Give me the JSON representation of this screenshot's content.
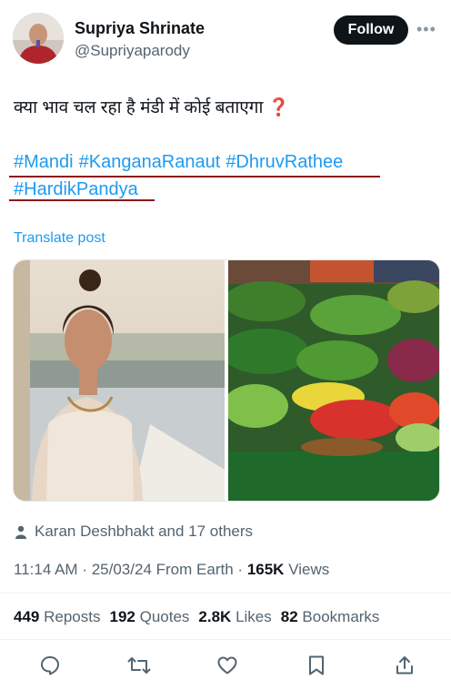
{
  "author": {
    "name": "Supriya Shrinate",
    "handle": "@Supriyaparody",
    "avatar_icon": "avatar-photo"
  },
  "header": {
    "follow_label": "Follow",
    "more_label": "•••"
  },
  "post": {
    "text": "क्या भाव चल रहा है मंडी में कोई बताएगा",
    "question_mark": "❓",
    "hashtags": [
      "#Mandi",
      "#KanganaRanaut",
      "#DhruvRathee",
      "#HardikPandya"
    ],
    "translate_label": "Translate post"
  },
  "media": {
    "left_image": "woman-portrait-photo",
    "right_image": "vegetable-market-photo"
  },
  "engagement": {
    "liked_by": "Karan Deshbhakt and 17 others"
  },
  "meta": {
    "time": "11:14 AM",
    "date": "25/03/24",
    "source": "From Earth",
    "views_count": "165K",
    "views_label": "Views",
    "sep": "·"
  },
  "stats": {
    "reposts_count": "449",
    "reposts_label": "Reposts",
    "quotes_count": "192",
    "quotes_label": "Quotes",
    "likes_count": "2.8K",
    "likes_label": "Likes",
    "bookmarks_count": "82",
    "bookmarks_label": "Bookmarks"
  },
  "colors": {
    "link": "#1d9bf0",
    "text": "#0f1419",
    "muted": "#536471",
    "annotation_underline": "#8b1a1a"
  }
}
